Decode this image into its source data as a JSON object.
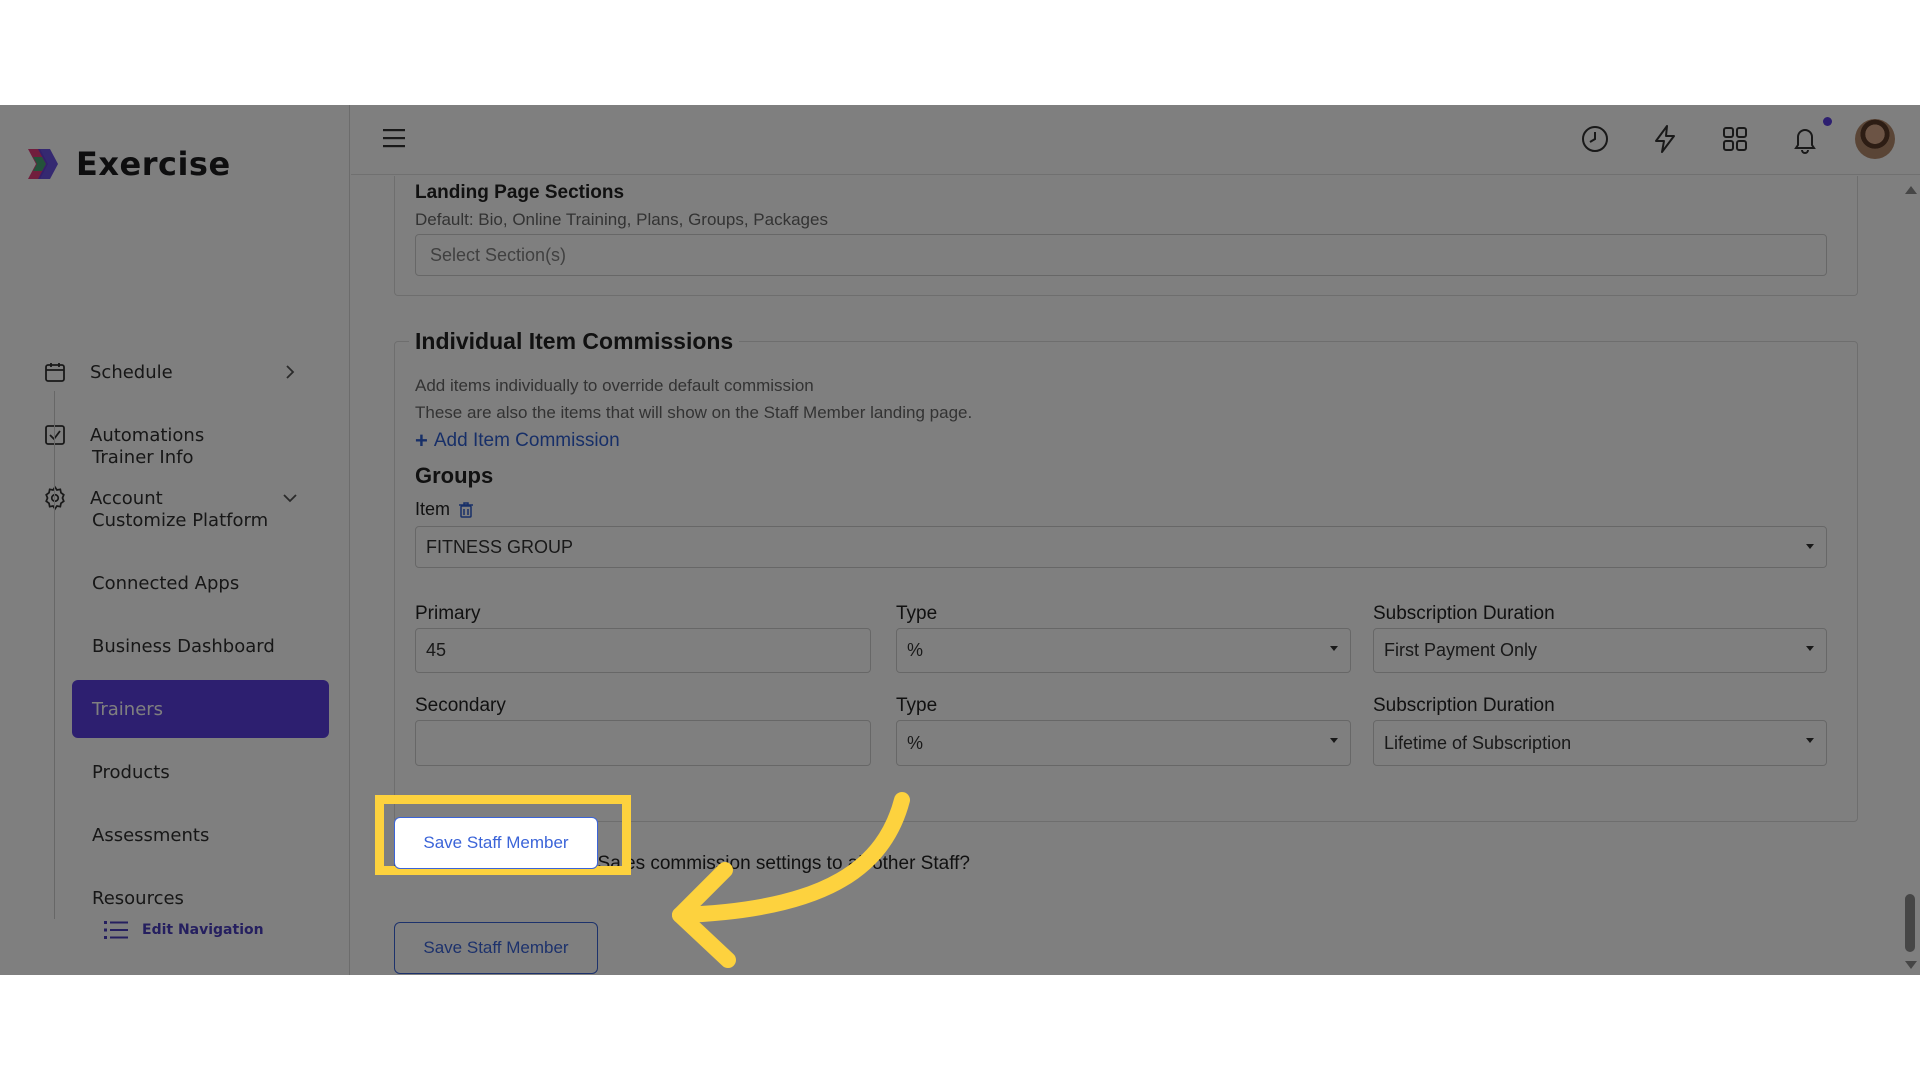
{
  "app": {
    "brand_name": "Exercise"
  },
  "sidebar": {
    "items": [
      {
        "label": "Schedule"
      },
      {
        "label": "Automations"
      },
      {
        "label": "Account"
      }
    ],
    "sub_items": [
      {
        "label": "Trainer Info"
      },
      {
        "label": "Customize Platform"
      },
      {
        "label": "Connected Apps"
      },
      {
        "label": "Business Dashboard"
      },
      {
        "label": "Trainers",
        "active": true
      },
      {
        "label": "Products"
      },
      {
        "label": "Assessments"
      },
      {
        "label": "Resources"
      }
    ],
    "edit_navigation": "Edit Navigation"
  },
  "topbar": {
    "icons": [
      "history-icon",
      "lightning-icon",
      "grid-icon",
      "bell-icon"
    ]
  },
  "landing": {
    "title": "Landing Page Sections",
    "default_text": "Default: Bio, Online Training, Plans, Groups, Packages",
    "placeholder": "Select Section(s)"
  },
  "commissions": {
    "title": "Individual Item Commissions",
    "desc1": "Add items individually to override default commission",
    "desc2": "These are also the items that will show on the Staff Member landing page.",
    "add_link": "Add Item Commission",
    "group_title": "Groups",
    "item_label": "Item",
    "item_value": "FITNESS GROUP",
    "primary_label": "Primary",
    "primary_value": "45",
    "type_label": "Type",
    "type1_value": "%",
    "duration_label": "Subscription Duration",
    "duration1_value": "First Payment Only",
    "secondary_label": "Secondary",
    "secondary_value": "",
    "type2_value": "%",
    "duration2_value": "Lifetime of Subscription"
  },
  "copy_settings": "Copy all Service and Sales commission settings to all other Staff?",
  "save_button": "Save Staff Member",
  "colors": {
    "accent": "#5b3fe0",
    "link": "#2f5fd0",
    "highlight": "#fdd23e"
  }
}
